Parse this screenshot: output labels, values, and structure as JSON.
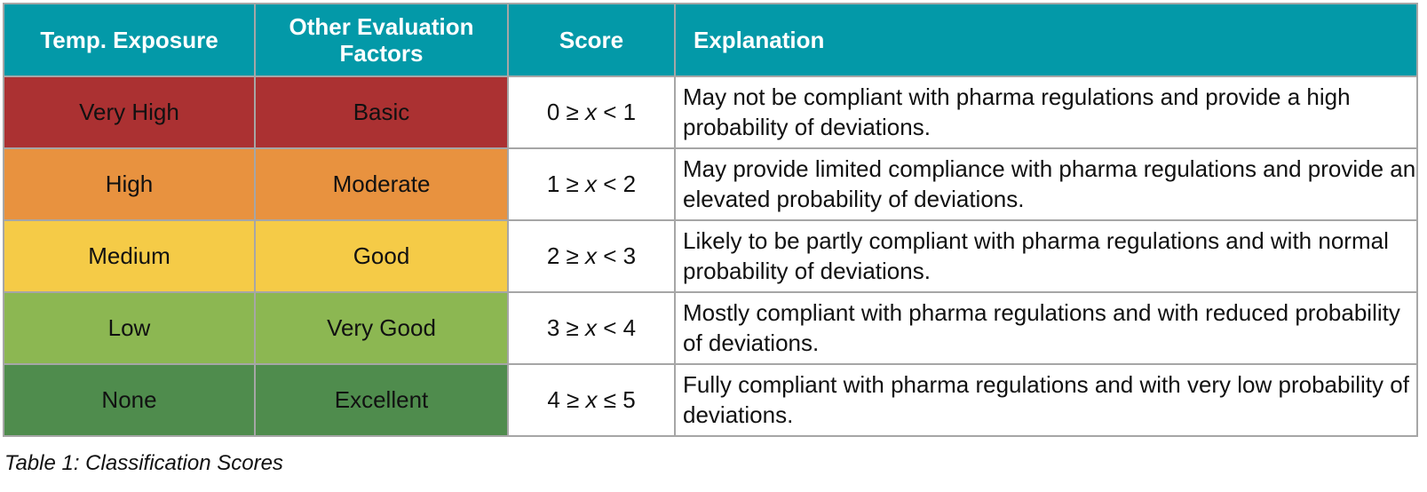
{
  "table": {
    "headers": [
      "Temp. Exposure",
      "Other Evaluation Factors",
      "Score",
      "Explanation"
    ],
    "rows": [
      {
        "exposure": "Very High",
        "factor": "Basic",
        "score_low": "0 ≥ ",
        "score_var": "x",
        "score_high": " < 1",
        "explanation": "May not be compliant with pharma regulations and provide a high probability of deviations.",
        "color": "#ab3132"
      },
      {
        "exposure": "High",
        "factor": "Moderate",
        "score_low": "1 ≥ ",
        "score_var": "x",
        "score_high": " < 2",
        "explanation": "May provide limited compliance with pharma regulations and provide an elevated probability of deviations.",
        "color": "#e8923f"
      },
      {
        "exposure": "Medium",
        "factor": "Good",
        "score_low": "2 ≥ ",
        "score_var": "x",
        "score_high": " < 3",
        "explanation": "Likely to be partly compliant with pharma regulations and with normal probability of deviations.",
        "color": "#f5cb47"
      },
      {
        "exposure": "Low",
        "factor": "Very Good",
        "score_low": "3 ≥ ",
        "score_var": "x",
        "score_high": " < 4",
        "explanation": "Mostly compliant with pharma regulations and with reduced probability of deviations.",
        "color": "#8cb752"
      },
      {
        "exposure": "None",
        "factor": "Excellent",
        "score_low": "4 ≥ ",
        "score_var": "x",
        "score_high": " ≤ 5",
        "explanation": "Fully compliant with pharma regulations and with very low probability of deviations.",
        "color": "#4f8c4d"
      }
    ],
    "header_color": "#0399a8"
  },
  "caption": "Table 1: Classification Scores"
}
